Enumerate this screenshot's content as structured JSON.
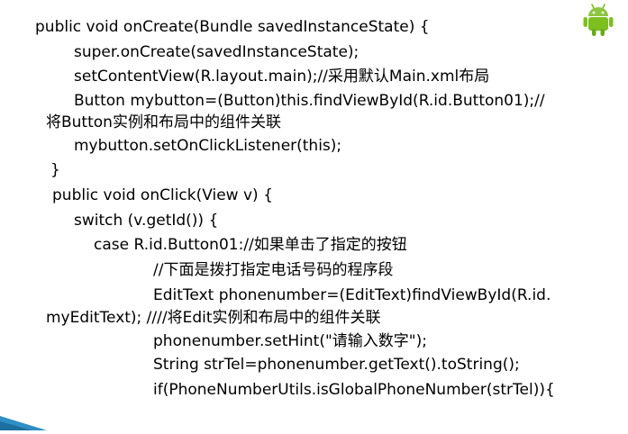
{
  "slide": {
    "logo_icon": "android-robot-icon",
    "accent_color": "#7cbf1f",
    "lines": [
      "public void onCreate(Bundle savedInstanceState) {",
      "super.onCreate(savedInstanceState);",
      "setContentView(R.layout.main);//采用默认Main.xml布局",
      "Button mybutton=(Button)this.findViewById(R.id.Button01);//",
      "将Button实例和布局中的组件关联",
      "mybutton.setOnClickListener(this);",
      "}",
      "public void onClick(View v) {",
      "switch (v.getId()) {",
      "case R.id.Button01://如果单击了指定的按钮",
      "//下面是拨打指定电话号码的程序段",
      "EditText phonenumber=(EditText)findViewById(R.id.",
      "myEditText); ////将Edit实例和布局中的组件关联",
      "phonenumber.setHint(\"请输入数字\");",
      "String strTel=phonenumber.getText().toString();",
      "if(PhoneNumberUtils.isGlobalPhoneNumber(strTel)){"
    ]
  }
}
